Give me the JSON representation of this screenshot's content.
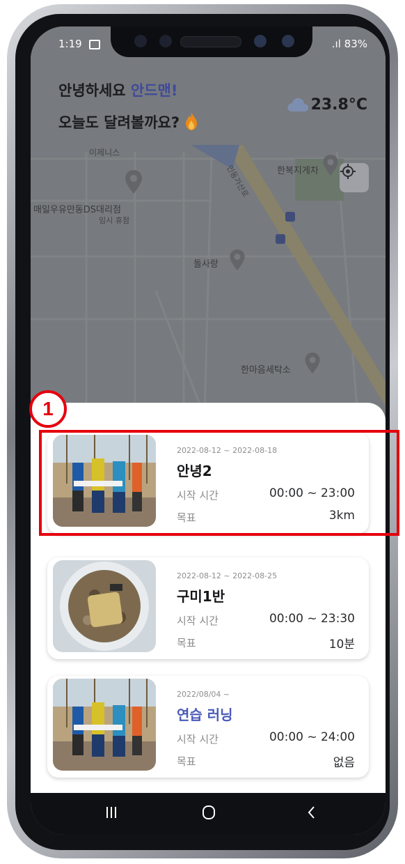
{
  "status": {
    "time": "1:19",
    "right": "⁠.ıl 83%"
  },
  "greeting": {
    "hello": "안녕하세요",
    "name": "안드맨!",
    "line2": "오늘도 달려볼까요?"
  },
  "weather": {
    "temp": "23.8°C"
  },
  "map_labels": {
    "store": "매일우유만동DS대리점",
    "store_sub": "임시 휴점",
    "l1": "한복지게차",
    "l2": "한마음세탁소",
    "l3": "돌사랑",
    "road": "인동가산로"
  },
  "annotation": {
    "number": "1"
  },
  "cards": [
    {
      "dates": "2022-08-12 ~ 2022-08-18",
      "title": "안녕2",
      "time_label": "시작 시간",
      "time": "00:00 ~ 23:00",
      "goal_label": "목표",
      "goal": "3km"
    },
    {
      "dates": "2022-08-12 ~ 2022-08-25",
      "title": "구미1반",
      "time_label": "시작 시간",
      "time": "00:00 ~ 23:30",
      "goal_label": "목표",
      "goal": "10분"
    },
    {
      "dates": "2022/08/04 ~",
      "title": "연습 러닝",
      "time_label": "시작 시간",
      "time": "00:00 ~ 24:00",
      "goal_label": "목표",
      "goal": "없음"
    }
  ],
  "colors": {
    "accent": "#4a5ab8",
    "annotation": "#e5000d"
  }
}
